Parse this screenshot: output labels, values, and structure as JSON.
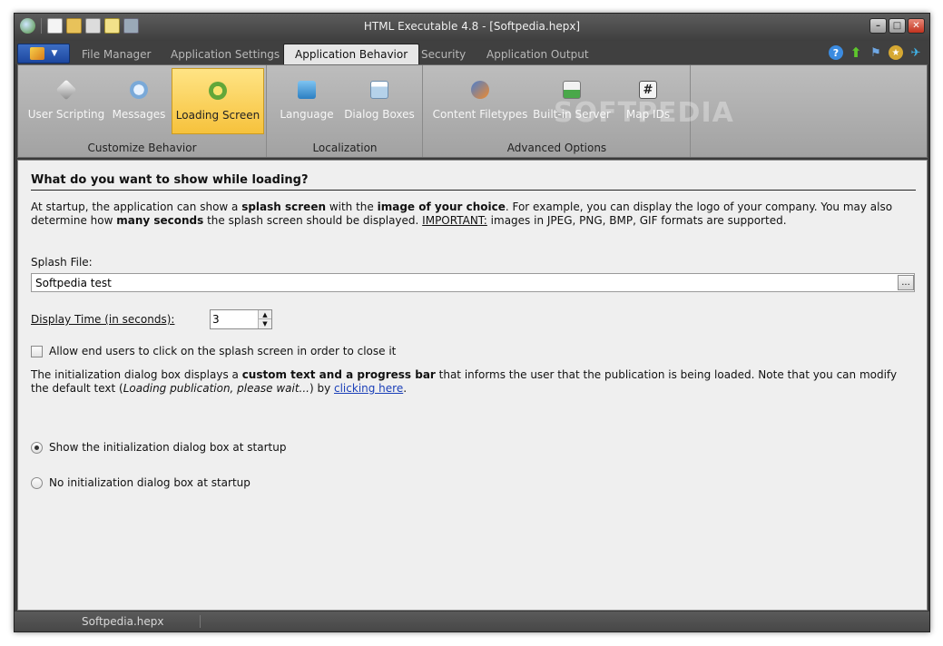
{
  "window": {
    "title": "HTML Executable 4.8 - [Softpedia.hepx]"
  },
  "tabs": [
    {
      "label": "File Manager"
    },
    {
      "label": "Application Settings"
    },
    {
      "label": "Application Behavior"
    },
    {
      "label": "Security"
    },
    {
      "label": "Application Output"
    }
  ],
  "ribbon": {
    "groups": [
      {
        "label": "Customize Behavior"
      },
      {
        "label": "Localization"
      },
      {
        "label": "Advanced Options"
      }
    ],
    "buttons": [
      {
        "label": "User Scripting",
        "icon": "script-icon"
      },
      {
        "label": "Messages",
        "icon": "messages-icon"
      },
      {
        "label": "Loading Screen",
        "icon": "loading-icon"
      },
      {
        "label": "Language",
        "icon": "language-icon"
      },
      {
        "label": "Dialog Boxes",
        "icon": "dialog-icon"
      },
      {
        "label": "Content Filetypes",
        "icon": "filetypes-icon"
      },
      {
        "label": "Built-in Server",
        "icon": "server-icon"
      },
      {
        "label": "Map IDs",
        "icon": "hash-icon",
        "glyph": "#"
      }
    ],
    "watermark": "SOFTPEDIA"
  },
  "content": {
    "heading": "What do you want to show while loading?",
    "intro": {
      "t1": "At startup, the application can show a ",
      "b1": "splash screen",
      "t2": " with the ",
      "b2": "image of your choice",
      "t3": ". For example, you can display the logo of your company. You may also determine how ",
      "b3": "many seconds",
      "t4": " the splash screen should be displayed. ",
      "u1": "IMPORTANT:",
      "t5": " images in JPEG, PNG, BMP, GIF formats are supported."
    },
    "splash_label": "Splash File:",
    "splash_value": "Softpedia test",
    "browse_label": "...",
    "display_time_label": "Display Time (in seconds):",
    "display_time_value": "3",
    "allow_close_label": "Allow end users to click on the splash screen in order to close it",
    "init": {
      "t1": "The initialization dialog box displays a ",
      "b1": "custom text and a progress bar",
      "t2": " that informs the user that the publication is being loaded. Note that you can modify the default text (",
      "i1": "Loading publication, please wait...",
      "t3": ") by ",
      "link": "clicking here",
      "t4": "."
    },
    "radio_show": "Show the initialization dialog box at startup",
    "radio_none": "No initialization dialog box at startup"
  },
  "statusbar": {
    "file": "Softpedia.hepx"
  }
}
